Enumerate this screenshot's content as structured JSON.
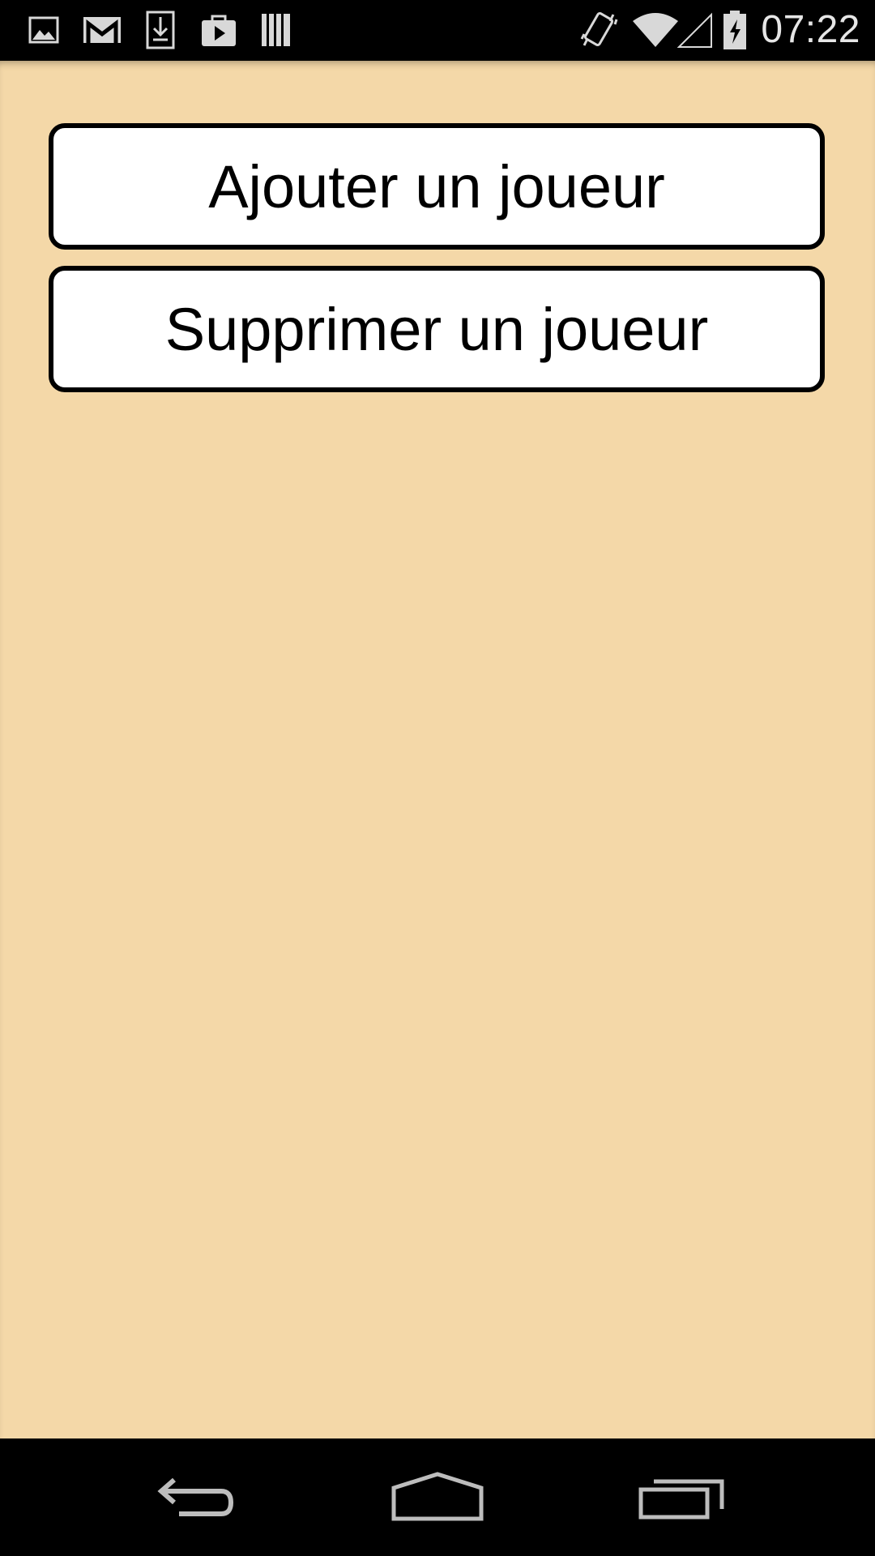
{
  "status_bar": {
    "time": "07:22",
    "left_icons": [
      "gallery-icon",
      "gmail-icon",
      "download-icon",
      "play-store-icon",
      "library-icon"
    ],
    "right_icons": [
      "vibrate-icon",
      "wifi-icon",
      "cell-signal-icon",
      "battery-charging-icon"
    ]
  },
  "main": {
    "background_color": "#f4d8a8",
    "buttons": [
      {
        "label": "Ajouter un joueur"
      },
      {
        "label": "Supprimer un joueur"
      }
    ]
  },
  "nav_bar": {
    "icons": [
      "back-icon",
      "home-icon",
      "recents-icon"
    ]
  }
}
